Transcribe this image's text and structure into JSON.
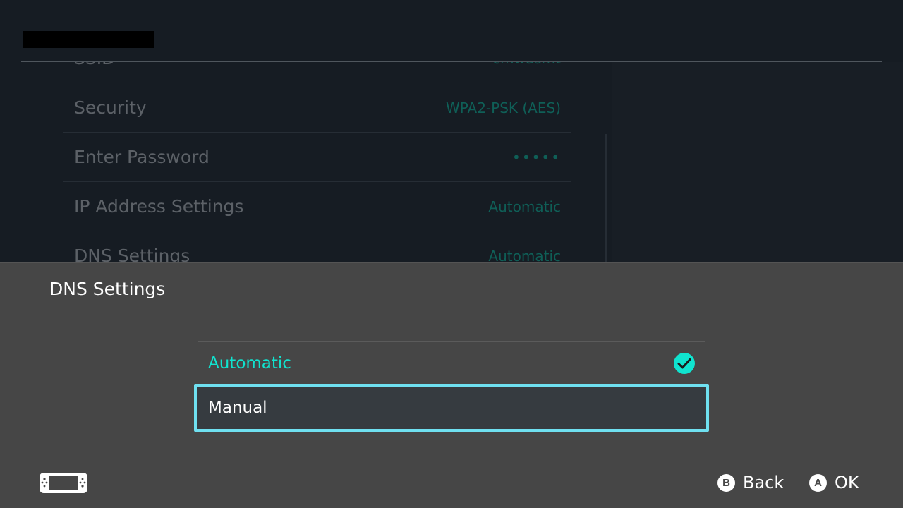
{
  "colors": {
    "background": "#161c23",
    "sheet": "#464646",
    "accent_teal": "#10e4cf",
    "focus_border": "#6fe0f0",
    "dim_value": "#0f5f57"
  },
  "background_screen": {
    "rows": [
      {
        "label": "SSID",
        "value": "cmwasmt"
      },
      {
        "label": "Security",
        "value": "WPA2-PSK (AES)"
      },
      {
        "label": "Enter Password",
        "value": "•••••"
      },
      {
        "label": "IP Address Settings",
        "value": "Automatic"
      },
      {
        "label": "DNS Settings",
        "value": "Automatic"
      }
    ]
  },
  "dialog": {
    "title": "DNS Settings",
    "options": [
      {
        "label": "Automatic",
        "selected": true
      },
      {
        "label": "Manual",
        "focused": true
      }
    ]
  },
  "footer": {
    "console_icon": "switch-console-icon",
    "back": {
      "glyph": "B",
      "label": "Back"
    },
    "ok": {
      "glyph": "A",
      "label": "OK"
    }
  }
}
